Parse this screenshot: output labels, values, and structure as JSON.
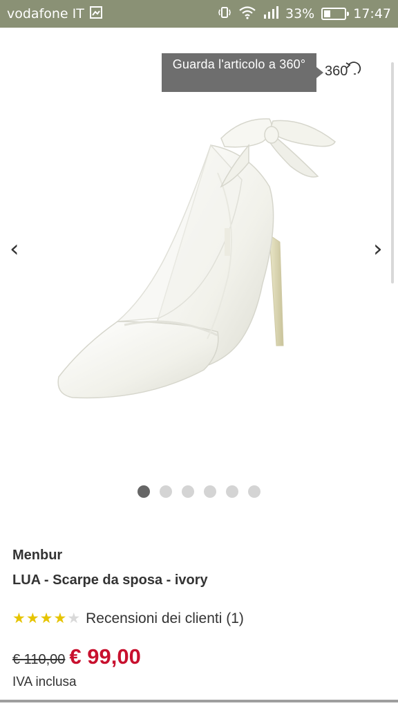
{
  "status_bar": {
    "carrier": "vodafone IT",
    "battery_percent": "33%",
    "battery_level": 0.33,
    "time": "17:47",
    "icons": [
      "image-icon",
      "vibrate-icon",
      "wifi-icon",
      "signal-icon",
      "battery-icon"
    ]
  },
  "gallery": {
    "tooltip": "Guarda l'articolo a 360°",
    "view360_label": "360",
    "prev_arrow": "‹",
    "next_arrow": "›",
    "image_count": 6,
    "active_index": 0
  },
  "product": {
    "brand": "Menbur",
    "name": "LUA - Scarpe da sposa - ivory",
    "rating": 4,
    "rating_max": 5,
    "reviews_label": "Recensioni dei clienti (1)",
    "old_price": "€ 110,00",
    "price": "€ 99,00",
    "vat": "IVA inclusa"
  },
  "colors": {
    "status_bar": "#8a9175",
    "price_red": "#c8102e",
    "star_yellow": "#e6c400"
  }
}
